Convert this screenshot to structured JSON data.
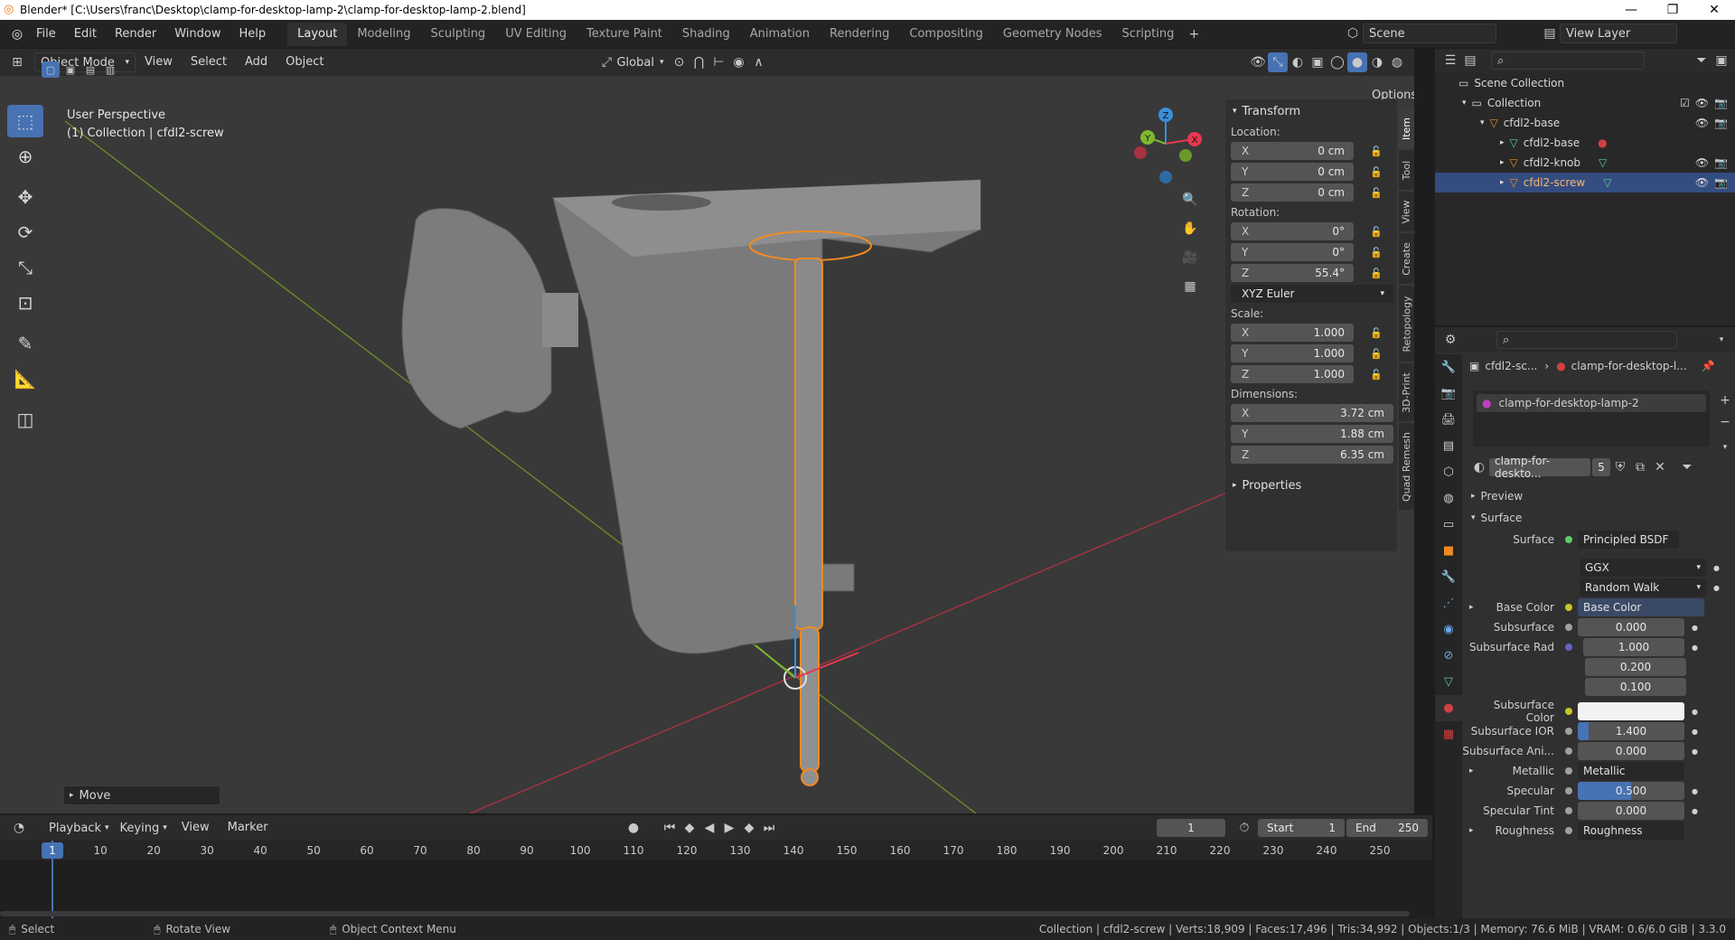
{
  "window": {
    "title": "Blender* [C:\\Users\\franc\\Desktop\\clamp-for-desktop-lamp-2\\clamp-for-desktop-lamp-2.blend]"
  },
  "menu": {
    "items": [
      "File",
      "Edit",
      "Render",
      "Window",
      "Help"
    ],
    "workspaces": [
      "Layout",
      "Modeling",
      "Sculpting",
      "UV Editing",
      "Texture Paint",
      "Shading",
      "Animation",
      "Rendering",
      "Compositing",
      "Geometry Nodes",
      "Scripting"
    ],
    "active_workspace": "Layout",
    "scene": "Scene",
    "view_layer": "View Layer"
  },
  "viewport": {
    "mode": "Object Mode",
    "menus": [
      "View",
      "Select",
      "Add",
      "Object"
    ],
    "orientation": "Global",
    "options_label": "Options",
    "perspective": "User Perspective",
    "collection_info": "(1) Collection | cfdl2-screw",
    "last_op": "Move",
    "gizmo_axes": [
      "X",
      "Y",
      "Z"
    ]
  },
  "npanel": {
    "title": "Transform",
    "location_label": "Location:",
    "location": [
      {
        "axis": "X",
        "value": "0 cm"
      },
      {
        "axis": "Y",
        "value": "0 cm"
      },
      {
        "axis": "Z",
        "value": "0 cm"
      }
    ],
    "rotation_label": "Rotation:",
    "rotation": [
      {
        "axis": "X",
        "value": "0°"
      },
      {
        "axis": "Y",
        "value": "0°"
      },
      {
        "axis": "Z",
        "value": "55.4°"
      }
    ],
    "rotation_mode": "XYZ Euler",
    "scale_label": "Scale:",
    "scale": [
      {
        "axis": "X",
        "value": "1.000"
      },
      {
        "axis": "Y",
        "value": "1.000"
      },
      {
        "axis": "Z",
        "value": "1.000"
      }
    ],
    "dimensions_label": "Dimensions:",
    "dimensions": [
      {
        "axis": "X",
        "value": "3.72 cm"
      },
      {
        "axis": "Y",
        "value": "1.88 cm"
      },
      {
        "axis": "Z",
        "value": "6.35 cm"
      }
    ],
    "properties_label": "Properties",
    "tabs": [
      "Item",
      "Tool",
      "View",
      "Create",
      "Retopology",
      "3D-Print",
      "Quad Remesh"
    ]
  },
  "outliner": {
    "rows": [
      {
        "label": "Scene Collection"
      },
      {
        "label": "Collection"
      },
      {
        "label": "cfdl2-base"
      },
      {
        "label": "cfdl2-base"
      },
      {
        "label": "cfdl2-knob"
      },
      {
        "label": "cfdl2-screw"
      }
    ]
  },
  "properties": {
    "breadcrumb_object": "cfdl2-sc...",
    "breadcrumb_material": "clamp-for-desktop-l...",
    "material_slot": "clamp-for-desktop-lamp-2",
    "material_name": "clamp-for-deskto...",
    "user_count": "5",
    "preview_label": "Preview",
    "surface_panel": "Surface",
    "surface_label": "Surface",
    "surface_value": "Principled BSDF",
    "distribution": "GGX",
    "subsurface_method": "Random Walk",
    "base_color_label": "Base Color",
    "base_color_value": "Base Color",
    "subsurface_label": "Subsurface",
    "subsurface_value": "0.000",
    "subsurface_rad_label": "Subsurface Rad",
    "subsurface_rad": [
      "1.000",
      "0.200",
      "0.100"
    ],
    "subsurface_color_label": "Subsurface Color",
    "subsurface_ior_label": "Subsurface IOR",
    "subsurface_ior_value": "1.400",
    "subsurface_ani_label": "Subsurface Ani...",
    "subsurface_ani_value": "0.000",
    "metallic_label": "Metallic",
    "metallic_value": "Metallic",
    "specular_label": "Specular",
    "specular_value": "0.500",
    "specular_tint_label": "Specular Tint",
    "specular_tint_value": "0.000",
    "roughness_label": "Roughness",
    "roughness_value": "Roughness"
  },
  "timeline": {
    "menus": [
      "Playback",
      "Keying",
      "View",
      "Marker"
    ],
    "current_frame": "1",
    "start_label": "Start",
    "start": "1",
    "end_label": "End",
    "end": "250",
    "ticks": [
      "1",
      "10",
      "20",
      "30",
      "40",
      "50",
      "60",
      "70",
      "80",
      "90",
      "100",
      "110",
      "120",
      "130",
      "140",
      "150",
      "160",
      "170",
      "180",
      "190",
      "200",
      "210",
      "220",
      "230",
      "240",
      "250"
    ]
  },
  "status": {
    "select": "Select",
    "rotate": "Rotate View",
    "context": "Object Context Menu",
    "info": "Collection | cfdl2-screw | Verts:18,909 | Faces:17,496 | Tris:34,992 | Objects:1/3 | Memory: 76.6 MiB | VRAM: 0.6/6.0 GiB | 3.3.0"
  },
  "colors": {
    "accent": "#4772b3",
    "selection_orange": "#f08a24",
    "x_axis": "#e8384f",
    "y_axis": "#7fb82f",
    "z_axis": "#3a8fd9"
  }
}
